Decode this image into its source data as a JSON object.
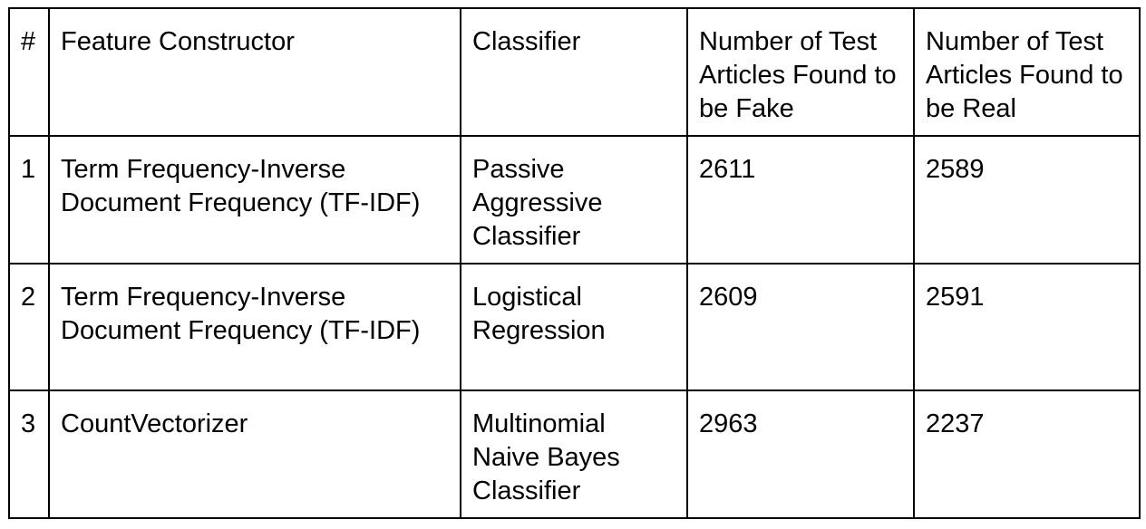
{
  "table": {
    "headers": [
      "#",
      "Feature Constructor",
      "Classifier",
      "Number of Test Articles Found to be Fake",
      "Number of Test Articles Found to be Real"
    ],
    "rows": [
      {
        "num": "1",
        "feature": "Term Frequency-Inverse Document Frequency (TF-IDF)",
        "classifier": "Passive Aggressive Classifier",
        "fake": "2611",
        "real": "2589"
      },
      {
        "num": "2",
        "feature": "Term Frequency-Inverse Document Frequency (TF-IDF)",
        "classifier": "Logistical Regression",
        "fake": "2609",
        "real": "2591"
      },
      {
        "num": "3",
        "feature": "CountVectorizer",
        "classifier": "Multinomial Naive Bayes Classifier",
        "fake": "2963",
        "real": "2237"
      }
    ]
  }
}
